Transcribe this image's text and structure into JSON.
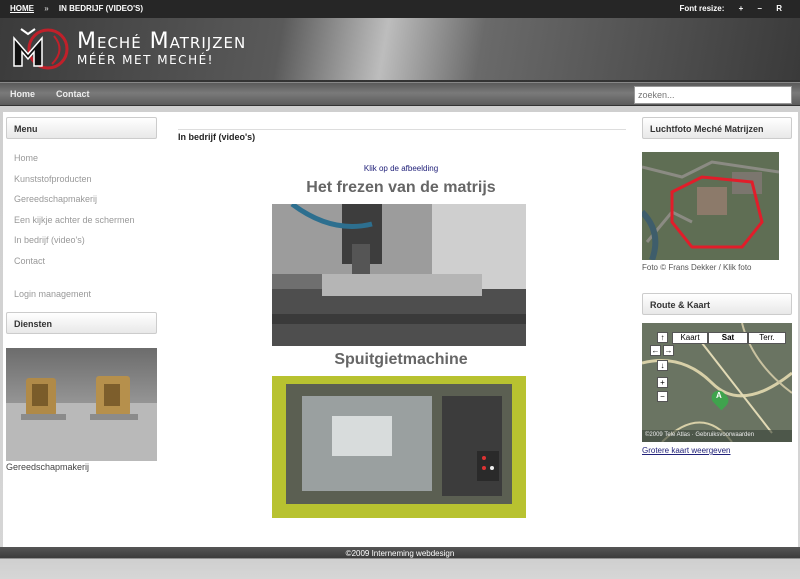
{
  "breadcrumb": {
    "home": "HOME",
    "current": "IN BEDRIJF (VIDEO'S)"
  },
  "font_resize": {
    "label": "Font resize:",
    "plus": "+",
    "minus": "–",
    "reset": "R"
  },
  "brand": {
    "name": "Meché Matrijzen",
    "tagline": "MÉÉR MET MECHÉ!"
  },
  "nav": {
    "items": [
      "Home",
      "Contact"
    ],
    "search_placeholder": "zoeken..."
  },
  "sidebar": {
    "menu_title": "Menu",
    "menu_items": [
      "Home",
      "Kunststofproducten",
      "Gereedschapmakerij",
      "Een kijkje achter de schermen",
      "In bedrijf (video's)",
      "Contact"
    ],
    "login": "Login management",
    "services_title": "Diensten",
    "services_caption": "Gereedschapmakerij"
  },
  "main": {
    "title": "In bedrijf (video's)",
    "click_hint": "Klik op de afbeelding",
    "video1_title": "Het frezen van de matrijs",
    "video2_title": "Spuitgietmachine"
  },
  "right": {
    "aerial_title": "Luchtfoto Meché Matrijzen",
    "aerial_caption": "Foto © Frans Dekker / Klik foto",
    "route_title": "Route & Kaart",
    "map_types": [
      "Kaart",
      "Sat",
      "Terr."
    ],
    "map_marker": "A",
    "map_footer": "©2009 Tele Atlas · Gebruiksvoorwaarden",
    "bigger_map": "Grotere kaart weergeven"
  },
  "footer": {
    "text": "©2009 Interneming webdesign"
  },
  "colors": {
    "accent": "#c0202a",
    "link": "#22227a"
  }
}
